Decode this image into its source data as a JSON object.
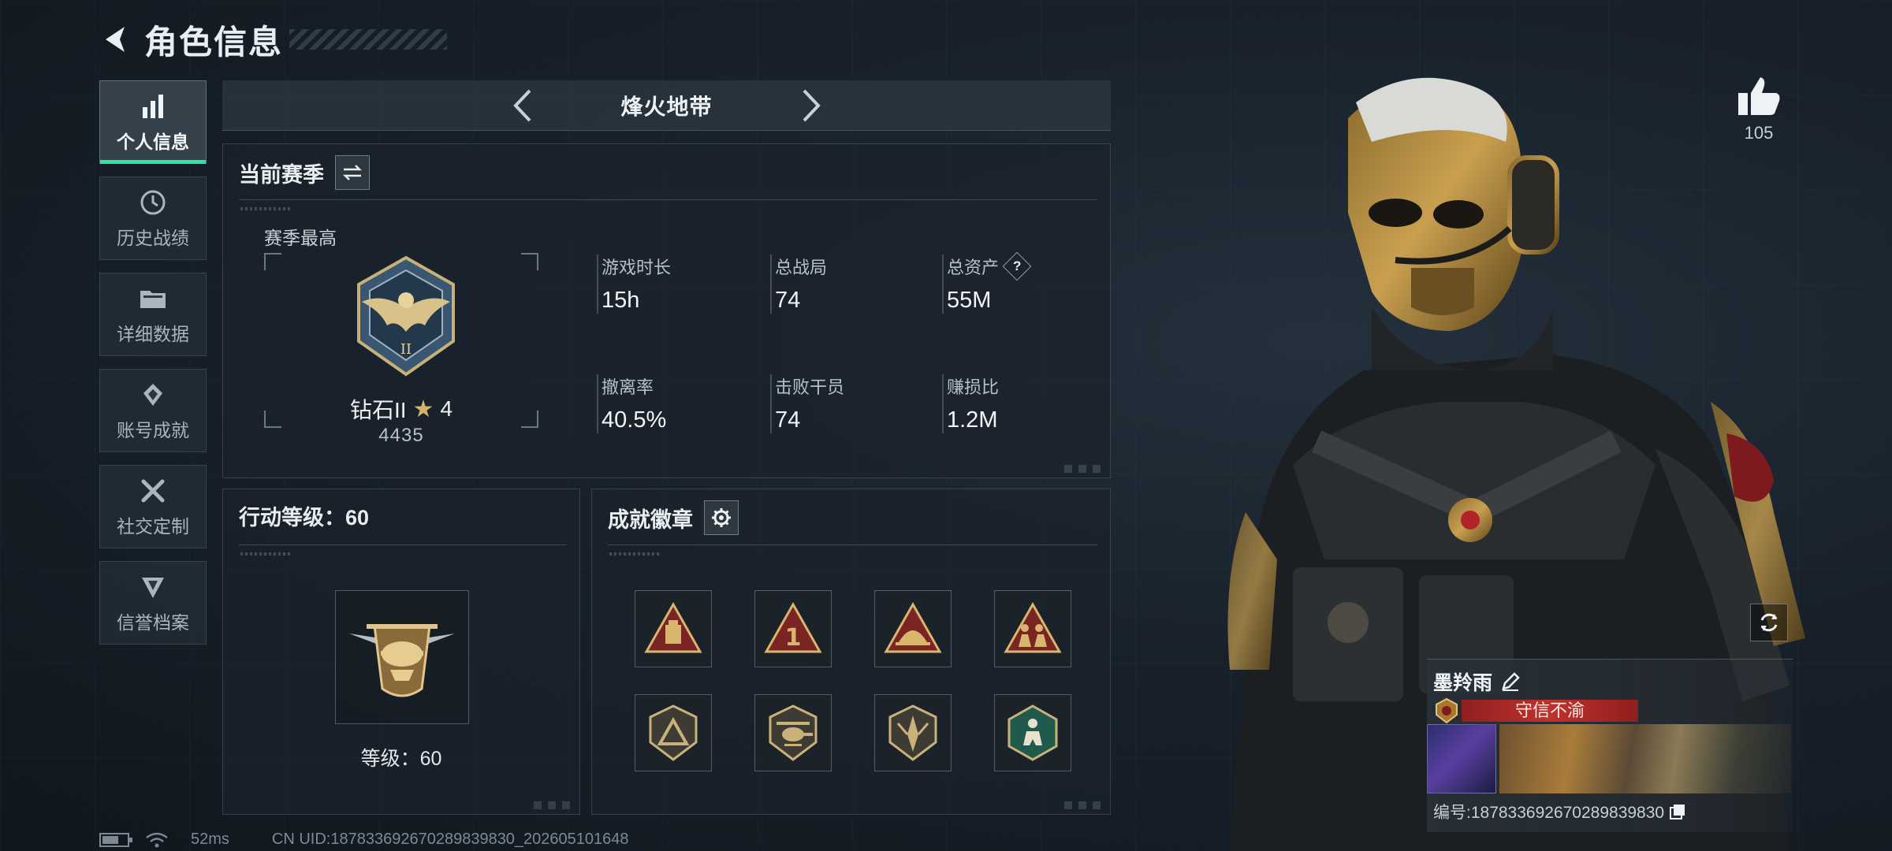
{
  "header": {
    "title": "角色信息"
  },
  "nav": {
    "items": [
      {
        "label": "个人信息",
        "icon": "bar-chart-icon",
        "active": true
      },
      {
        "label": "历史战绩",
        "icon": "history-icon",
        "active": false
      },
      {
        "label": "详细数据",
        "icon": "folder-icon",
        "active": false
      },
      {
        "label": "账号成就",
        "icon": "achievement-icon",
        "active": false
      },
      {
        "label": "社交定制",
        "icon": "tools-icon",
        "active": false
      },
      {
        "label": "信誉档案",
        "icon": "credit-icon",
        "active": false
      }
    ]
  },
  "map_switcher": {
    "current": "烽火地带"
  },
  "season": {
    "title": "当前赛季",
    "best_label": "赛季最高",
    "rank_name": "钻石II",
    "rank_stars": "4",
    "rank_score": "4435",
    "stats": [
      {
        "label": "游戏时长",
        "value": "15h"
      },
      {
        "label": "总战局",
        "value": "74"
      },
      {
        "label": "总资产",
        "value": "55M",
        "help": "?"
      },
      {
        "label": "撤离率",
        "value": "40.5%"
      },
      {
        "label": "击败干员",
        "value": "74"
      },
      {
        "label": "赚损比",
        "value": "1.2M"
      }
    ]
  },
  "level_panel": {
    "title": "行动等级：60",
    "level_text": "等级：60"
  },
  "achievements": {
    "title": "成就徽章",
    "badges": [
      {
        "icon": "supply-badge-icon"
      },
      {
        "icon": "number-one-badge-icon"
      },
      {
        "icon": "dome-badge-icon"
      },
      {
        "icon": "squad-badge-icon"
      },
      {
        "icon": "triangle-shield-badge-icon"
      },
      {
        "icon": "helicopter-badge-icon"
      },
      {
        "icon": "blade-shield-badge-icon"
      },
      {
        "icon": "hexagon-runner-badge-icon"
      }
    ]
  },
  "likes": {
    "count": "105"
  },
  "player": {
    "name": "墨羚雨",
    "title": "守信不渝",
    "id_label": "编号:1878336926702898398​30"
  },
  "status_bar": {
    "ping": "52ms",
    "uid": "CN UID:187833692670289839830_202605101648"
  },
  "colors": {
    "accent": "#2ee5a6",
    "title_red": "#c0312d",
    "gold": "#d4b46a"
  }
}
